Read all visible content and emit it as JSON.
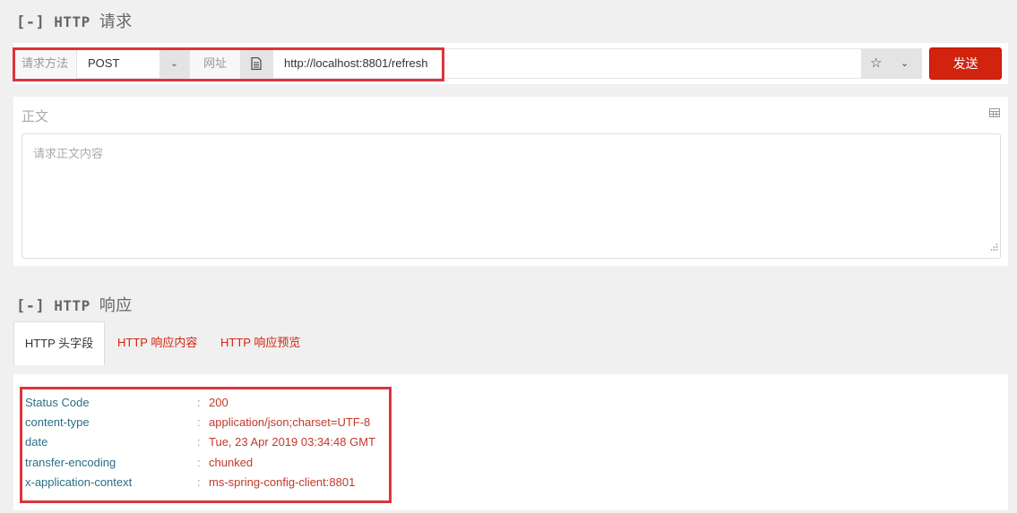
{
  "request": {
    "section_toggle": "[-]",
    "section_proto": "HTTP",
    "section_label": "请求",
    "method_label": "请求方法",
    "method_value": "POST",
    "url_label": "网址",
    "url_value": "http://localhost:8801/refresh",
    "send_label": "发送",
    "body_title": "正文",
    "body_placeholder": "请求正文内容"
  },
  "response": {
    "section_toggle": "[-]",
    "section_proto": "HTTP",
    "section_label": "响应",
    "tabs": [
      {
        "label": "HTTP 头字段"
      },
      {
        "label": "HTTP 响应内容"
      },
      {
        "label": "HTTP 响应预览"
      }
    ],
    "separator": ":",
    "headers": [
      {
        "key": "Status Code",
        "value": "200"
      },
      {
        "key": "content-type",
        "value": "application/json;charset=UTF-8"
      },
      {
        "key": "date",
        "value": "Tue, 23 Apr 2019 03:34:48 GMT"
      },
      {
        "key": "transfer-encoding",
        "value": "chunked"
      },
      {
        "key": "x-application-context",
        "value": "ms-spring-config-client:8801"
      }
    ]
  },
  "icons": {
    "method_caret": "chevron-down-icon",
    "url_doc": "document-icon",
    "favorite": "star-icon",
    "favorite_caret": "chevron-down-icon",
    "body_format": "table-icon",
    "resize": "resize-grip-icon"
  },
  "colors": {
    "accent": "#d2230f",
    "header_key": "#2a6f86",
    "header_value": "#c0392b",
    "highlight": "#d9363e"
  }
}
